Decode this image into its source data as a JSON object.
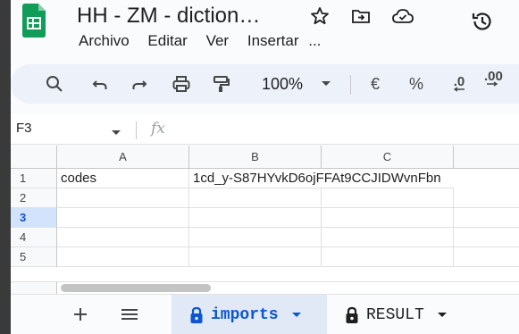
{
  "header": {
    "title": "HH - ZM - diction…",
    "menu": [
      "Archivo",
      "Editar",
      "Ver",
      "Insertar",
      "..."
    ]
  },
  "toolbar": {
    "zoom": "100%",
    "currency": "€",
    "percent": "%",
    "dec_decrease": ".0",
    "dec_increase": ".00"
  },
  "formula_bar": {
    "cell_ref": "F3",
    "fx": "fx"
  },
  "grid": {
    "columns": [
      "A",
      "B",
      "C",
      ""
    ],
    "rows": [
      "1",
      "2",
      "3",
      "4",
      "5"
    ],
    "cells": {
      "A1": "codes",
      "B1": "1cd_y-S87HYvkD6ojFFAt9CCJIDWvnFbn"
    },
    "selected_row": "3"
  },
  "sheets": {
    "active": "imports",
    "other": "RESULT"
  },
  "colors": {
    "accent": "#0b57d0",
    "sheets_green": "#0f9d58"
  }
}
